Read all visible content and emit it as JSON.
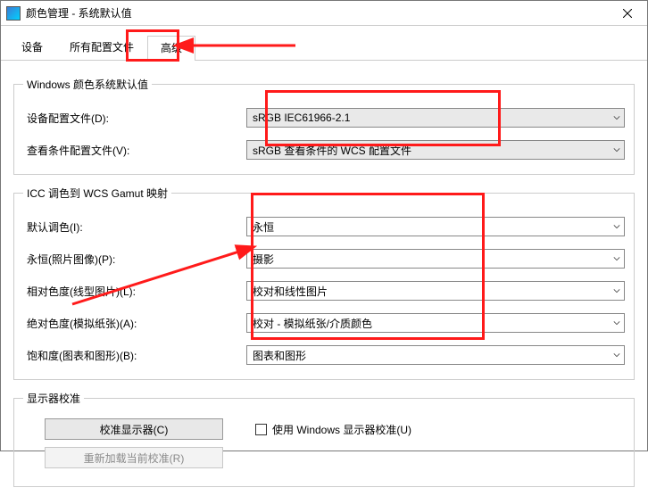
{
  "window": {
    "title": "颜色管理 - 系统默认值",
    "close_icon": "×"
  },
  "tabs": {
    "devices": "设备",
    "all_profiles": "所有配置文件",
    "advanced": "高级"
  },
  "section_defaults": {
    "legend": "Windows 颜色系统默认值",
    "device_profile_label": "设备配置文件(D):",
    "device_profile_value": "sRGB IEC61966-2.1",
    "viewing_profile_label": "查看条件配置文件(V):",
    "viewing_profile_value": "sRGB 查看条件的 WCS 配置文件"
  },
  "section_icc": {
    "legend": "ICC 调色到 WCS Gamut 映射",
    "default_intent_label": "默认调色(I):",
    "default_intent_value": "永恒",
    "perceptual_label": "永恒(照片图像)(P):",
    "perceptual_value": "摄影",
    "relative_label": "相对色度(线型图片)(L):",
    "relative_value": "校对和线性图片",
    "absolute_label": "绝对色度(模拟纸张)(A):",
    "absolute_value": "校对 - 模拟纸张/介质颜色",
    "saturation_label": "饱和度(图表和图形)(B):",
    "saturation_value": "图表和图形"
  },
  "section_cal": {
    "legend": "显示器校准",
    "calibrate_btn": "校准显示器(C)",
    "use_windows_cal": "使用 Windows 显示器校准(U)",
    "reload_btn": "重新加载当前校准(R)"
  }
}
